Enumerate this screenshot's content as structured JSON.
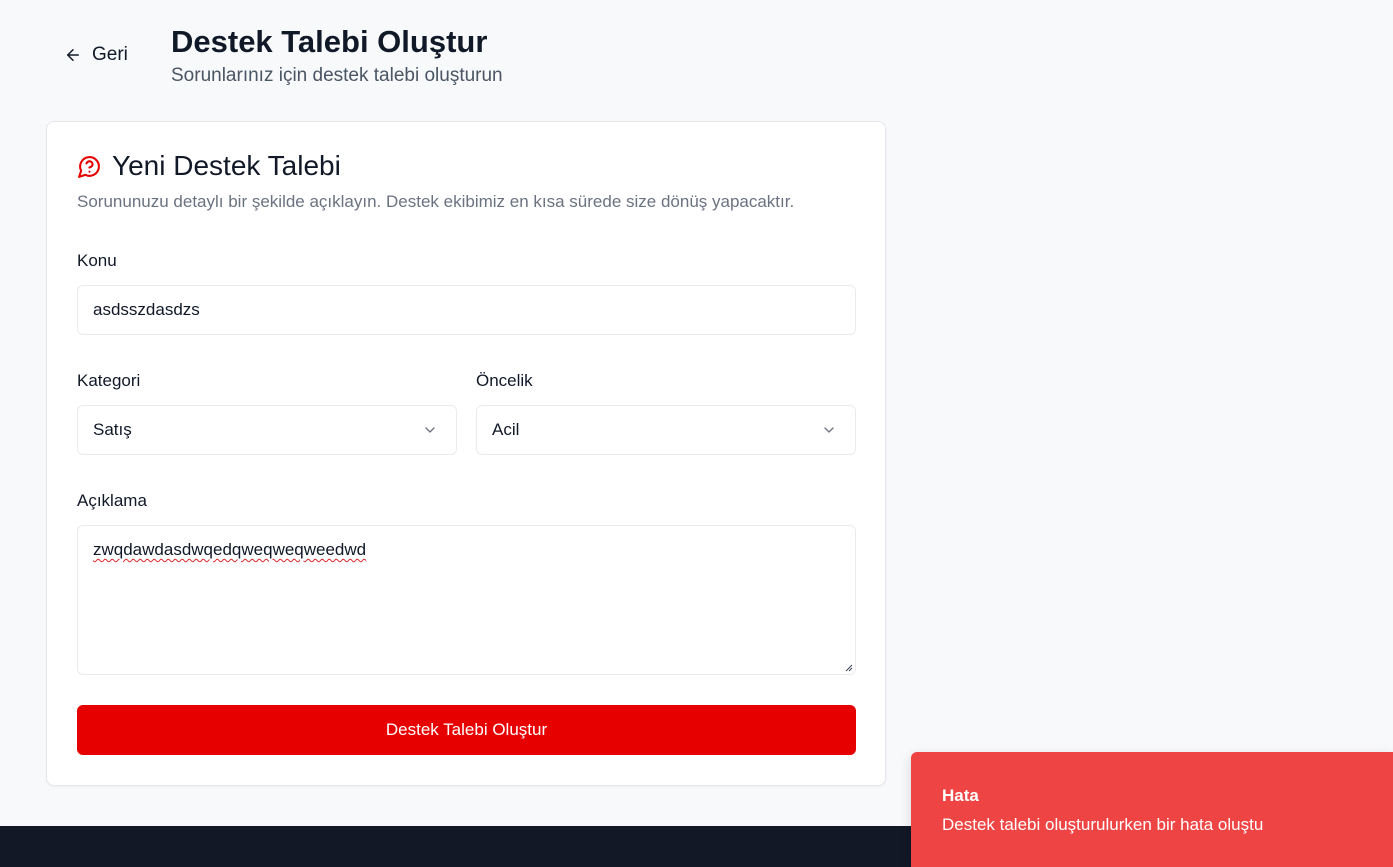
{
  "header": {
    "back_label": "Geri",
    "title": "Destek Talebi Oluştur",
    "subtitle": "Sorunlarınız için destek talebi oluşturun"
  },
  "card": {
    "title": "Yeni Destek Talebi",
    "description": "Sorununuzu detaylı bir şekilde açıklayın. Destek ekibimiz en kısa sürede size dönüş yapacaktır.",
    "icon": "help-circle-icon",
    "accent_color": "#e60000"
  },
  "form": {
    "subject": {
      "label": "Konu",
      "value": "asdsszdasdzs"
    },
    "category": {
      "label": "Kategori",
      "value": "Satış"
    },
    "priority": {
      "label": "Öncelik",
      "value": "Acil"
    },
    "description": {
      "label": "Açıklama",
      "value": "zwqdawdasdwqedqweqweqweedwd"
    },
    "submit_label": "Destek Talebi Oluştur"
  },
  "toast": {
    "title": "Hata",
    "message": "Destek talebi oluşturulurken bir hata oluştu",
    "color": "#ef4444"
  }
}
